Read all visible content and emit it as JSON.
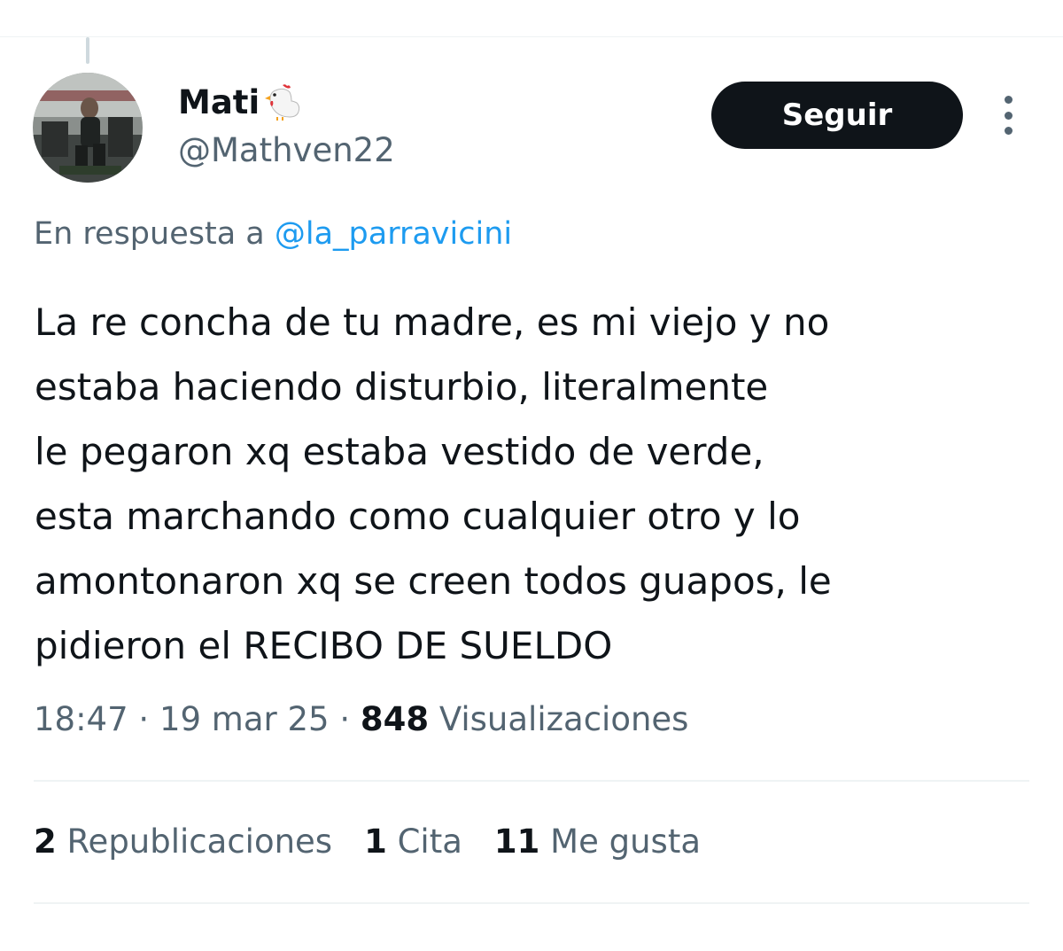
{
  "user": {
    "display_name": "Mati",
    "name_emoji": "chicken-icon",
    "handle": "@Mathven22",
    "avatar": "gym-photo-avatar"
  },
  "actions": {
    "follow_label": "Seguir",
    "more_icon": "more-options-icon"
  },
  "reply": {
    "prefix": "En respuesta a ",
    "mention": "@la_parravicini"
  },
  "tweet": {
    "lines": [
      "La re concha de tu madre, es mi viejo y no",
      "estaba haciendo disturbio, literalmente",
      "le pegaron xq estaba vestido de verde,",
      "esta marchando como cualquier otro y lo",
      "amontonaron xq se creen todos guapos, le",
      "pidieron el RECIBO DE SUELDO"
    ]
  },
  "meta": {
    "time": "18:47",
    "date": "19 mar 25",
    "separator": "·",
    "views_count": "848",
    "views_label": "Visualizaciones"
  },
  "stats": {
    "reposts_count": "2",
    "reposts_label": "Republicaciones",
    "quotes_count": "1",
    "quotes_label": "Cita",
    "likes_count": "11",
    "likes_label": "Me gusta"
  },
  "colors": {
    "text_primary": "#0f1419",
    "text_secondary": "#536471",
    "link": "#1d9bf0",
    "button_bg": "#0f1419",
    "divider": "#eff3f4"
  }
}
